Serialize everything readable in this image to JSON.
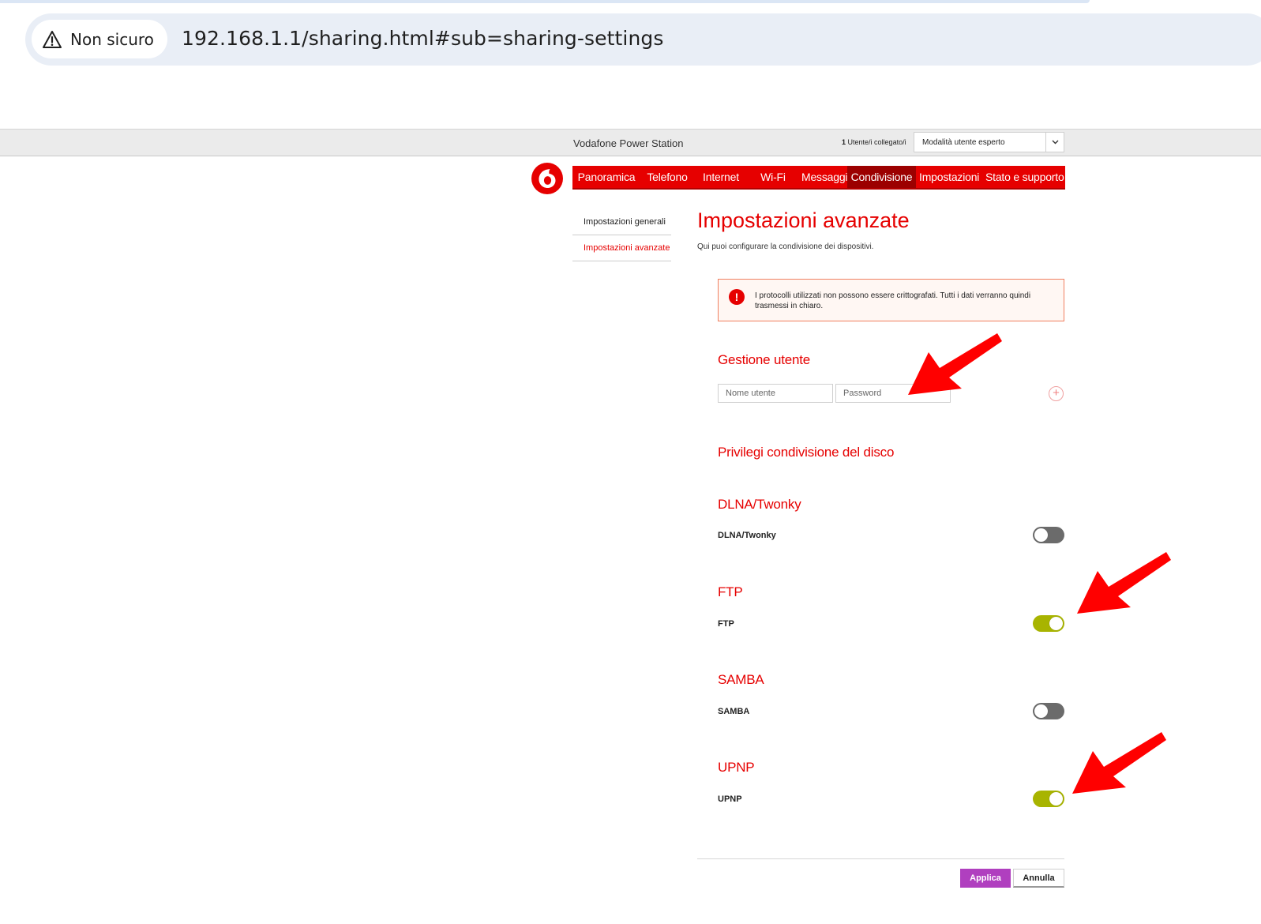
{
  "browser": {
    "security_label": "Non sicuro",
    "url": "192.168.1.1/sharing.html#sub=sharing-settings"
  },
  "header": {
    "product_name": "Vodafone Power Station",
    "users_count": "1",
    "users_label": "Utente/i collegato/i",
    "mode_select_value": "Modalità utente esperto"
  },
  "nav": {
    "items": [
      {
        "label": "Panoramica"
      },
      {
        "label": "Telefono"
      },
      {
        "label": "Internet"
      },
      {
        "label": "Wi-Fi"
      },
      {
        "label": "Messaggi"
      },
      {
        "label": "Condivisione"
      },
      {
        "label": "Impostazioni"
      },
      {
        "label": "Stato e supporto"
      }
    ],
    "active": "Condivisione"
  },
  "sidebar": {
    "items": [
      {
        "label": "Impostazioni generali"
      },
      {
        "label": "Impostazioni avanzate"
      }
    ],
    "active": "Impostazioni avanzate"
  },
  "page": {
    "title": "Impostazioni avanzate",
    "description": "Qui puoi configurare la condivisione dei dispositivi."
  },
  "alert": {
    "text": "I protocolli utilizzati non possono essere crittografati. Tutti i dati verranno quindi trasmessi in chiaro.",
    "icon": "!"
  },
  "user_management": {
    "title": "Gestione utente",
    "username_placeholder": "Nome utente",
    "password_placeholder": "Password",
    "add_symbol": "+"
  },
  "disk_privileges": {
    "title": "Privilegi condivisione del disco"
  },
  "services": [
    {
      "title": "DLNA/Twonky",
      "label": "DLNA/Twonky",
      "enabled": false
    },
    {
      "title": "FTP",
      "label": "FTP",
      "enabled": true
    },
    {
      "title": "SAMBA",
      "label": "SAMBA",
      "enabled": false
    },
    {
      "title": "UPNP",
      "label": "UPNP",
      "enabled": true
    }
  ],
  "buttons": {
    "apply": "Applica",
    "cancel": "Annulla"
  },
  "colors": {
    "brand_red": "#e60000",
    "toggle_on": "#a8b400",
    "toggle_off": "#6b6b6b",
    "apply_button": "#b03fbf",
    "annotation_arrow": "#ff0000"
  },
  "icons": [
    "warning-triangle-icon",
    "chevron-down-icon",
    "vodafone-logo",
    "alert-exclamation-icon",
    "plus-circle-icon",
    "red-annotation-arrow"
  ]
}
